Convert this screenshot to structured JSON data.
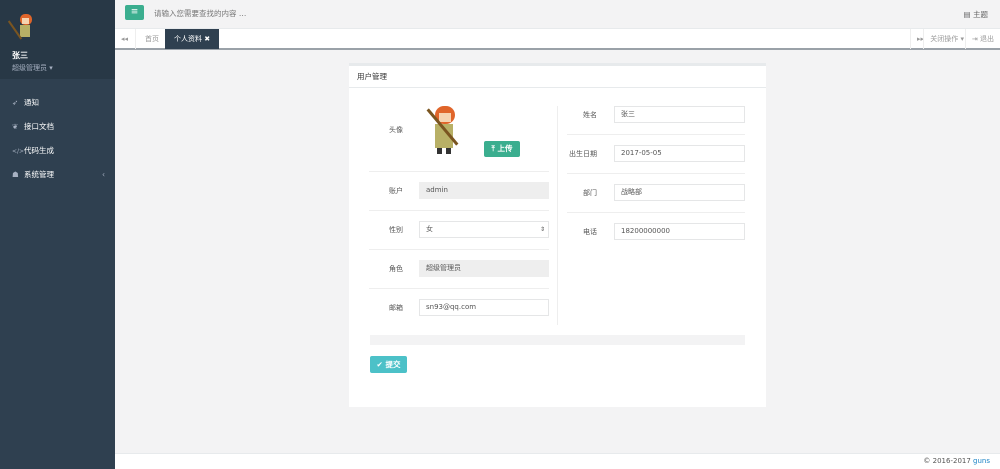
{
  "user": {
    "name": "张三",
    "role": "超级管理员"
  },
  "sidebar": {
    "items": [
      {
        "label": "通知",
        "icon": "paper-plane-icon"
      },
      {
        "label": "接口文档",
        "icon": "leaf-icon"
      },
      {
        "label": "代码生成",
        "icon": "code-icon"
      },
      {
        "label": "系统管理",
        "icon": "user-icon"
      }
    ]
  },
  "topbar": {
    "search_placeholder": "请输入您需要查找的内容 …",
    "theme": "主题"
  },
  "tabs": {
    "home": "首页",
    "profile": "个人资料",
    "close_ops": "关闭操作",
    "logout": "退出"
  },
  "panel": {
    "title": "用户管理",
    "left": {
      "avatar_label": "头像",
      "upload": "上传",
      "account_label": "账户",
      "account": "admin",
      "sex_label": "性别",
      "sex": "女",
      "role_label": "角色",
      "role": "超级管理员",
      "email_label": "邮箱",
      "email": "sn93@qq.com"
    },
    "right": {
      "name_label": "姓名",
      "name": "张三",
      "birthday_label": "出生日期",
      "birthday": "2017-05-05",
      "dept_label": "部门",
      "dept": "战略部",
      "phone_label": "电话",
      "phone": "18200000000"
    },
    "submit": "提交"
  },
  "footer": {
    "copyright": "© 2016-2017 ",
    "brand": "guns"
  },
  "colors": {
    "sidebar": "#2f4050",
    "primary": "#3bae8f",
    "info": "#4cc1c8"
  }
}
